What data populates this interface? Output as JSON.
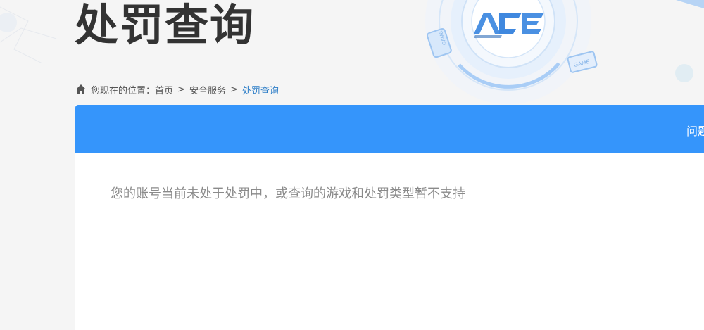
{
  "page": {
    "title": "处罚查询"
  },
  "breadcrumb": {
    "prefix": "您现在的位置：",
    "home": "首页",
    "separator": ">",
    "security": "安全服务",
    "current": "处罚查询"
  },
  "header": {
    "link_label": "问题"
  },
  "result": {
    "message": "您的账号当前未处于处罚中，或查询的游戏和处罚类型暂不支持"
  },
  "hero": {
    "logo_text": "ACE",
    "badge_text": "GAME"
  },
  "colors": {
    "header_blue": "#3595fb",
    "breadcrumb_active": "#2f7fc8",
    "title": "#333333",
    "message": "#8a8a8a"
  }
}
